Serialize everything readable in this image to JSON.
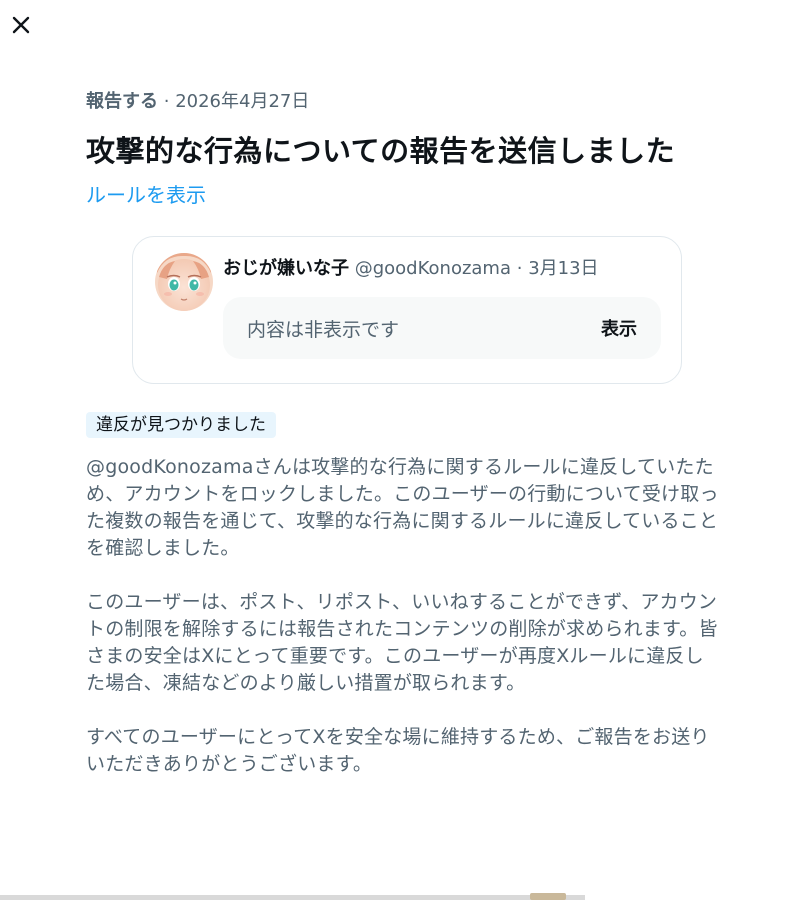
{
  "icons": {
    "close": "close-icon"
  },
  "report": {
    "action": "報告する",
    "separator": "·",
    "date": "2026年4月27日",
    "title": "攻撃的な行為についての報告を送信しました",
    "rules_link": "ルールを表示"
  },
  "post": {
    "author_name": "おじが嫌いな子",
    "handle": "@goodKonozama",
    "separator": "·",
    "date": "3月13日",
    "hidden_text": "内容は非表示です",
    "show_label": "表示"
  },
  "result": {
    "badge": "違反が見つかりました",
    "paragraphs": [
      "@goodKonozamaさんは攻撃的な行為に関するルールに違反していたため、アカウントをロックしました。このユーザーの行動について受け取った複数の報告を通じて、攻撃的な行為に関するルールに違反していることを確認しました。",
      "このユーザーは、ポスト、リポスト、いいねすることができず、アカウントの制限を解除するには報告されたコンテンツの削除が求められます。皆さまの安全はXにとって重要です。このユーザーが再度Xルールに違反した場合、凍結などのより厳しい措置が取られます。",
      "すべてのユーザーにとってXを安全な場に維持するため、ご報告をお送りいただきありがとうございます。"
    ]
  },
  "colors": {
    "link": "#1d9bf0",
    "muted_text": "#536471",
    "primary_text": "#0f1419",
    "badge_bg": "#e8f5fd"
  }
}
